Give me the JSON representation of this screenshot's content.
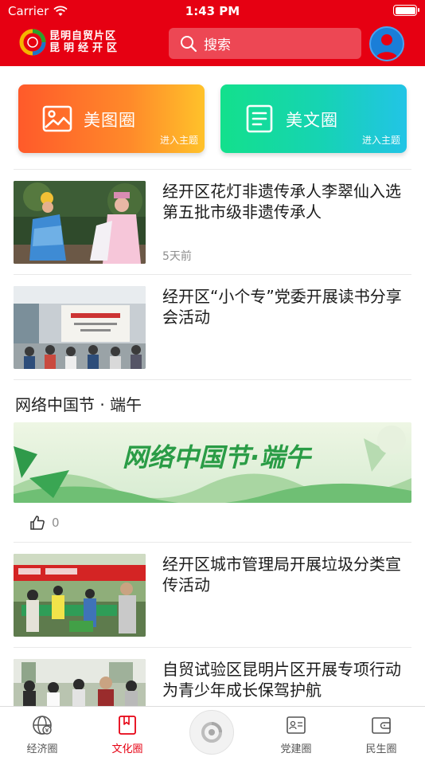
{
  "status_bar": {
    "carrier": "Carrier",
    "time": "1:43 PM"
  },
  "header": {
    "logo_line1": "昆明自贸片区",
    "logo_line2": "昆明经开区",
    "search_placeholder": "搜索"
  },
  "categories": [
    {
      "label": "美图圈",
      "sub": "进入主题"
    },
    {
      "label": "美文圈",
      "sub": "进入主题"
    }
  ],
  "news": [
    {
      "title": "经开区花灯非遗传承人李翠仙入选第五批市级非遗传承人",
      "meta": "5天前"
    },
    {
      "title": "经开区“小个专”党委开展读书分享会活动",
      "meta": ""
    },
    {
      "title": "经开区城市管理局开展垃圾分类宣传活动",
      "meta": ""
    },
    {
      "title": "自贸试验区昆明片区开展专项行动 为青少年成长保驾护航",
      "meta": ""
    }
  ],
  "topic": {
    "title": "网络中国节 · 端午",
    "banner_text": "网络中国节·端午",
    "like_count": "0"
  },
  "tabbar": [
    {
      "label": "经济圈",
      "active": false
    },
    {
      "label": "文化圈",
      "active": true
    },
    {
      "label": "党建圈",
      "active": false
    },
    {
      "label": "民生圈",
      "active": false
    }
  ],
  "colors": {
    "brand_red": "#e60012",
    "active_tab": "#e60012"
  }
}
